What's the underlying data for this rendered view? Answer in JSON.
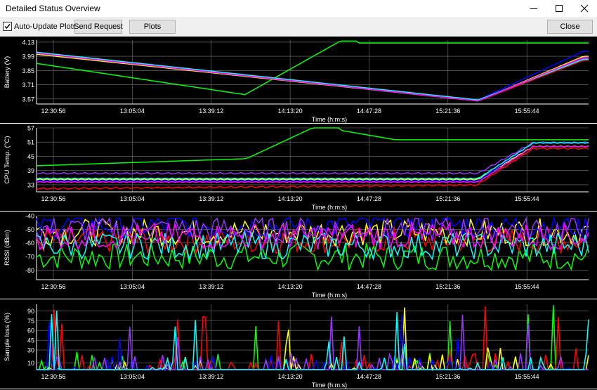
{
  "window": {
    "title": "Detailed Status Overview",
    "controls": [
      "minimize",
      "maximize",
      "close"
    ]
  },
  "toolbar": {
    "auto_update": {
      "label": "Auto-Update Plots",
      "checked": true
    },
    "send_request_label": "Send Request",
    "plots_label": "Plots",
    "close_label": "Close"
  },
  "series_colors": [
    "#00ff00",
    "#ff0000",
    "#ffff00",
    "#0000ff",
    "#9933ff",
    "#00ffff",
    "#ff00ff",
    "#ffffff"
  ],
  "chart_data": [
    {
      "type": "line",
      "ylabel": "Battery (V)",
      "xlabel": "Time (h:m:s)",
      "yticks": [
        "4.13",
        "3.99",
        "3.85",
        "3.71",
        "3.57"
      ],
      "ylim": [
        3.52,
        4.15
      ],
      "xticks": [
        "12:30:56",
        "13:05:04",
        "13:39:12",
        "14:13:20",
        "14:47:28",
        "15:21:36",
        "15:55:44"
      ],
      "grid": true
    },
    {
      "type": "line",
      "ylabel": "CPU Temp. (°C)",
      "xlabel": "Time (h:m:s)",
      "yticks": [
        "57",
        "51",
        "45",
        "39",
        "33"
      ],
      "ylim": [
        30,
        57
      ],
      "xticks": [
        "12:30:56",
        "13:05:04",
        "13:39:12",
        "14:13:20",
        "14:47:28",
        "15:21:36",
        "15:55:44"
      ],
      "grid": true
    },
    {
      "type": "line",
      "ylabel": "RSSI (dBm)",
      "xlabel": "Time (h:m:s)",
      "yticks": [
        "-40",
        "-50",
        "-60",
        "-70",
        "-80"
      ],
      "ylim": [
        -87,
        -40
      ],
      "xticks": [
        "12:30:56",
        "13:05:04",
        "13:39:12",
        "14:13:20",
        "14:47:28",
        "15:21:36",
        "15:55:44"
      ],
      "grid": true
    },
    {
      "type": "line",
      "ylabel": "Sample loss (%)",
      "xlabel": "Time (h:m:s)",
      "yticks": [
        "90",
        "75",
        "60",
        "45",
        "30",
        "10"
      ],
      "ylim": [
        0,
        100
      ],
      "xticks": [
        "12:30:56",
        "13:05:04",
        "13:39:12",
        "14:13:20",
        "14:47:28",
        "15:21:36",
        "15:55:44"
      ],
      "grid": true
    }
  ]
}
